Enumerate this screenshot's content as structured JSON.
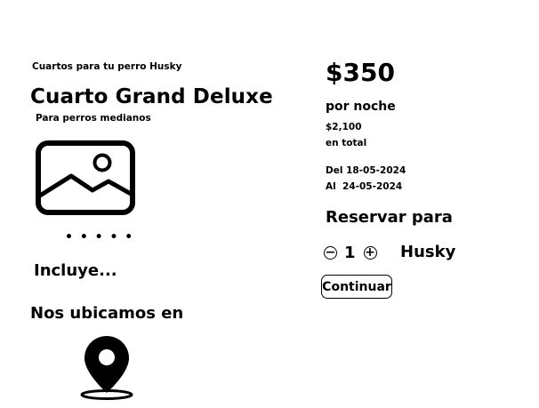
{
  "listing": {
    "eyebrow": "Cuartos para tu perro Husky",
    "title": "Cuarto Grand Deluxe",
    "subtitle": "Para perros medianos",
    "gallery_icon": "image-icon",
    "gallery_dots": "• • • • •",
    "includes_label": "Incluye...",
    "location_heading": "Nos ubicamos en",
    "location_icon": "map-pin-icon"
  },
  "booking": {
    "price": "$350",
    "per_night": "por noche",
    "total_amount": "$2,100",
    "total_label": "en total",
    "date_from": "Del 18-05-2024",
    "date_to": "Al  24-05-2024",
    "reserve_heading": "Reservar para",
    "decrement_symbol": "−",
    "quantity": "1",
    "increment_symbol": "+",
    "pet_name": "Husky",
    "continue_label": "Continuar"
  }
}
